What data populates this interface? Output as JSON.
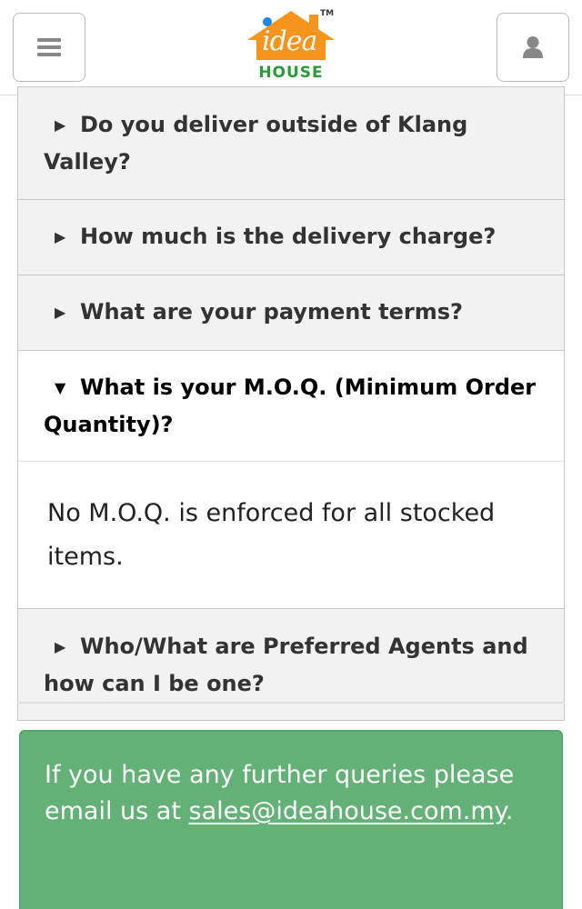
{
  "header": {
    "menu_icon": "hamburger-menu-icon",
    "user_icon": "user-icon",
    "logo": {
      "word_main": "idea",
      "word_sub": "HOUSE",
      "trademark": "TM",
      "colors": {
        "roof": "#f7941d",
        "dot": "#1e88e5",
        "text": "#2a9a3a"
      }
    }
  },
  "faq": {
    "items": [
      {
        "question": "Do you deliver outside of Klang Valley?",
        "expanded": false
      },
      {
        "question": "How much is the delivery charge?",
        "expanded": false
      },
      {
        "question": "What are your payment terms?",
        "expanded": false
      },
      {
        "question": "What is your M.O.Q. (Minimum Order Quantity)?",
        "answer": "No M.O.Q. is enforced for all stocked items.",
        "expanded": true
      },
      {
        "question": "Who/What are Preferred Agents and how can I be one?",
        "expanded": false
      }
    ],
    "caret_collapsed": "▶",
    "caret_expanded": "▼"
  },
  "contact": {
    "text_before": "If you have any further queries please email us at ",
    "email": "sales@ideahouse.com.my",
    "text_after": ".",
    "background_color": "#63b176"
  }
}
